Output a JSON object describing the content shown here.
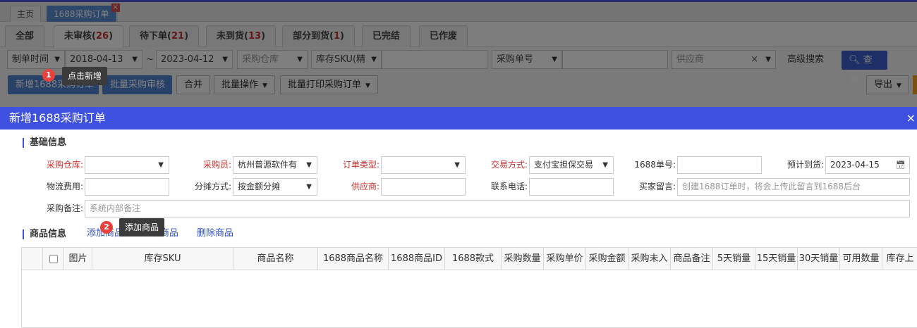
{
  "doc_tabs": {
    "home": "主页",
    "active": "1688采购订单",
    "close": "×"
  },
  "status_tabs": [
    {
      "label": "全部",
      "count": ""
    },
    {
      "label": "未审核",
      "count": "26"
    },
    {
      "label": "待下单",
      "count": "21"
    },
    {
      "label": "未到货",
      "count": "13"
    },
    {
      "label": "部分到货",
      "count": "1"
    },
    {
      "label": "已完结",
      "count": ""
    },
    {
      "label": "已作废",
      "count": ""
    }
  ],
  "filters": {
    "date_type": "制单时间",
    "date_from": "2018-04-13",
    "date_sep": "~",
    "date_to": "2023-04-12",
    "warehouse": "采购仓库",
    "sku_type": "库存SKU(精",
    "order_no_type": "采购单号",
    "supplier": "供应商",
    "clear": "×",
    "advanced": "高级搜索",
    "search": "查询"
  },
  "actions": {
    "new_order": "新增1688采购订单",
    "batch_review": "批量采购审核",
    "merge": "合并",
    "batch_ops": "批量操作",
    "batch_print": "批量打印采购订单",
    "export": "导出"
  },
  "tips": [
    {
      "num": "1",
      "text": "点击新增"
    },
    {
      "num": "2",
      "text": "添加商品"
    }
  ],
  "modal": {
    "title": "新增1688采购订单",
    "close": "×",
    "basic_title": "基础信息",
    "fields": {
      "warehouse_label": "采购仓库:",
      "warehouse_value": "",
      "buyer_label": "采购员:",
      "buyer_value": "杭州普源软件有",
      "order_type_label": "订单类型:",
      "order_type_value": "",
      "trade_label": "交易方式:",
      "trade_value": "支付宝担保交易",
      "order1688_label": "1688单号:",
      "order1688_value": "",
      "eta_label": "预计到货:",
      "eta_value": "2023-04-15",
      "freight_label": "物流费用:",
      "freight_value": "",
      "split_label": "分摊方式:",
      "split_value": "按金额分摊",
      "supplier_label": "供应商:",
      "supplier_value": "",
      "phone_label": "联系电话:",
      "phone_value": "",
      "buyer_msg_label": "买家留言:",
      "buyer_msg_placeholder": "创建1688订单时，将会上传此留言到1688后台",
      "remark_label": "采购备注:",
      "remark_placeholder": "系统内部备注"
    },
    "goods_title": "商品信息",
    "goods_links": {
      "add": "添加商品",
      "import": "导入商品",
      "delete": "删除商品"
    },
    "columns": [
      "",
      "图片",
      "库存SKU",
      "商品名称",
      "1688商品名称",
      "1688商品ID",
      "1688款式",
      "采购数量",
      "采购单价",
      "采购金额",
      "采购未入",
      "商品备注",
      "5天销量",
      "15天销量",
      "30天销量",
      "可用数量",
      "库存上"
    ]
  }
}
